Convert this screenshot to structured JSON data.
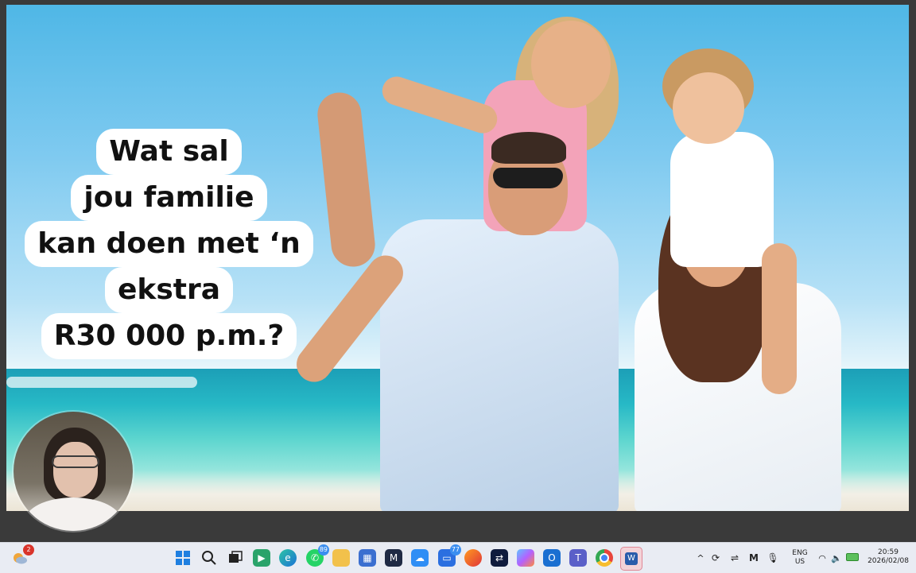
{
  "slide": {
    "headline_lines": [
      "Wat sal",
      "jou familie",
      "kan doen met ‘n",
      "ekstra",
      "R30 000 p.m.?"
    ]
  },
  "taskbar": {
    "icons": [
      {
        "name": "weather-widget-icon",
        "badge": "2"
      },
      {
        "name": "windows-start-icon"
      },
      {
        "name": "search-icon"
      },
      {
        "name": "task-view-icon"
      },
      {
        "name": "meet-icon"
      },
      {
        "name": "edge-icon"
      },
      {
        "name": "whatsapp-icon",
        "badge": "89"
      },
      {
        "name": "file-explorer-icon"
      },
      {
        "name": "store-icon"
      },
      {
        "name": "app-m-icon"
      },
      {
        "name": "onedrive-icon"
      },
      {
        "name": "chat-icon",
        "badge": "77"
      },
      {
        "name": "firefox-icon"
      },
      {
        "name": "teamviewer-icon"
      },
      {
        "name": "copilot-icon"
      },
      {
        "name": "outlook-icon"
      },
      {
        "name": "teams-icon"
      },
      {
        "name": "chrome-icon"
      },
      {
        "name": "word-icon"
      }
    ],
    "tray": {
      "language_top": "ENG",
      "language_bottom": "US",
      "time": "20:59",
      "date": "2026/02/08"
    }
  }
}
